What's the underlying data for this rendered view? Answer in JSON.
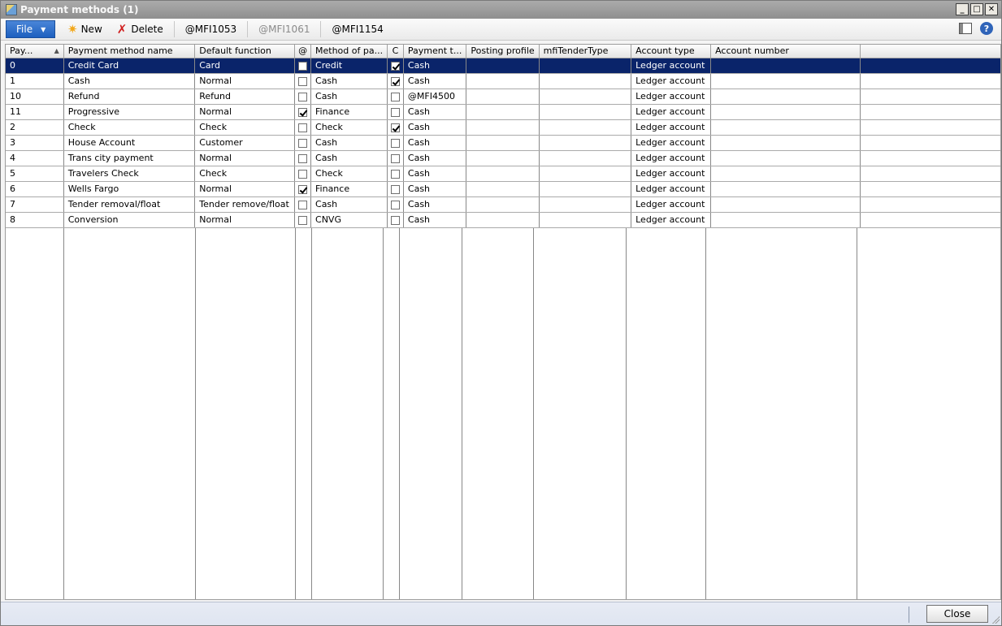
{
  "window": {
    "title": "Payment methods (1)",
    "controls": {
      "minimize": "_",
      "maximize": "□",
      "close": "✕"
    }
  },
  "toolbar": {
    "file_label": "File",
    "new_label": "New",
    "delete_label": "Delete",
    "item1_label": "@MFI1053",
    "item2_label": "@MFI1061",
    "item3_label": "@MFI1154",
    "help_glyph": "?"
  },
  "grid": {
    "headers": [
      "Pay...",
      "Payment method name",
      "Default function",
      "@",
      "Method of pa...",
      "C",
      "Payment t...",
      "Posting profile",
      "mfiTenderType",
      "Account type",
      "Account number"
    ],
    "rows": [
      {
        "id": "0",
        "name": "Credit Card",
        "func": "Card",
        "at": false,
        "method": "Credit",
        "c": true,
        "ptype": "Cash",
        "posting": "",
        "tender": "",
        "acctype": "Ledger account",
        "accnum": ""
      },
      {
        "id": "1",
        "name": "Cash",
        "func": "Normal",
        "at": false,
        "method": "Cash",
        "c": true,
        "ptype": "Cash",
        "posting": "",
        "tender": "",
        "acctype": "Ledger account",
        "accnum": ""
      },
      {
        "id": "10",
        "name": "Refund",
        "func": "Refund",
        "at": false,
        "method": "Cash",
        "c": false,
        "ptype": "@MFI4500",
        "posting": "",
        "tender": "",
        "acctype": "Ledger account",
        "accnum": ""
      },
      {
        "id": "11",
        "name": "Progressive",
        "func": "Normal",
        "at": true,
        "method": "Finance",
        "c": false,
        "ptype": "Cash",
        "posting": "",
        "tender": "",
        "acctype": "Ledger account",
        "accnum": ""
      },
      {
        "id": "2",
        "name": "Check",
        "func": "Check",
        "at": false,
        "method": "Check",
        "c": true,
        "ptype": "Cash",
        "posting": "",
        "tender": "",
        "acctype": "Ledger account",
        "accnum": ""
      },
      {
        "id": "3",
        "name": "House Account",
        "func": "Customer",
        "at": false,
        "method": "Cash",
        "c": false,
        "ptype": "Cash",
        "posting": "",
        "tender": "",
        "acctype": "Ledger account",
        "accnum": ""
      },
      {
        "id": "4",
        "name": "Trans city payment",
        "func": "Normal",
        "at": false,
        "method": "Cash",
        "c": false,
        "ptype": "Cash",
        "posting": "",
        "tender": "",
        "acctype": "Ledger account",
        "accnum": ""
      },
      {
        "id": "5",
        "name": "Travelers Check",
        "func": "Check",
        "at": false,
        "method": "Check",
        "c": false,
        "ptype": "Cash",
        "posting": "",
        "tender": "",
        "acctype": "Ledger account",
        "accnum": ""
      },
      {
        "id": "6",
        "name": "Wells Fargo",
        "func": "Normal",
        "at": true,
        "method": "Finance",
        "c": false,
        "ptype": "Cash",
        "posting": "",
        "tender": "",
        "acctype": "Ledger account",
        "accnum": ""
      },
      {
        "id": "7",
        "name": "Tender removal/float",
        "func": "Tender remove/float",
        "at": false,
        "method": "Cash",
        "c": false,
        "ptype": "Cash",
        "posting": "",
        "tender": "",
        "acctype": "Ledger account",
        "accnum": ""
      },
      {
        "id": "8",
        "name": "Conversion",
        "func": "Normal",
        "at": false,
        "method": "CNVG",
        "c": false,
        "ptype": "Cash",
        "posting": "",
        "tender": "",
        "acctype": "Ledger account",
        "accnum": ""
      }
    ],
    "selected_row": 0
  },
  "footer": {
    "close_label": "Close"
  }
}
